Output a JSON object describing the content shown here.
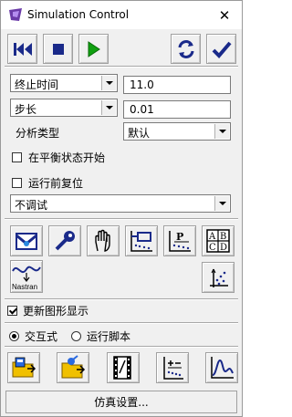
{
  "window": {
    "title": "Simulation Control"
  },
  "toolbar": {
    "icons": [
      "rewind-icon",
      "stop-icon",
      "play-icon",
      "refresh-icon",
      "checkmark-icon"
    ]
  },
  "params": {
    "end_time_label": "终止时间",
    "end_time_value": "11.0",
    "step_label": "步长",
    "step_value": "0.01",
    "analysis_type_label": "分析类型",
    "analysis_type_value": "默认"
  },
  "options": {
    "start_at_equilibrium": {
      "label": "在平衡状态开始",
      "checked": false
    },
    "reset_before_run": {
      "label": "运行前复位",
      "checked": false
    },
    "debug_value": "不调试"
  },
  "tools": {
    "row1": [
      "sensor-icon",
      "wrench-key-icon",
      "hand-icon",
      "plot-marker-icon",
      "plot-p-icon",
      "abcd-table-icon"
    ],
    "row2_left": "Nastran",
    "row2_right": "scatter-axis-icon"
  },
  "update_graphics": {
    "label": "更新图形显示",
    "checked": true
  },
  "mode": {
    "interactive_label": "交互式",
    "script_label": "运行脚本",
    "selected": "interactive"
  },
  "bottom_tools": [
    "load-sim-icon",
    "open-folder-icon",
    "film-icon",
    "axis-plusminus-icon",
    "plot-curve-icon"
  ],
  "sim_settings_label": "仿真设置..."
}
